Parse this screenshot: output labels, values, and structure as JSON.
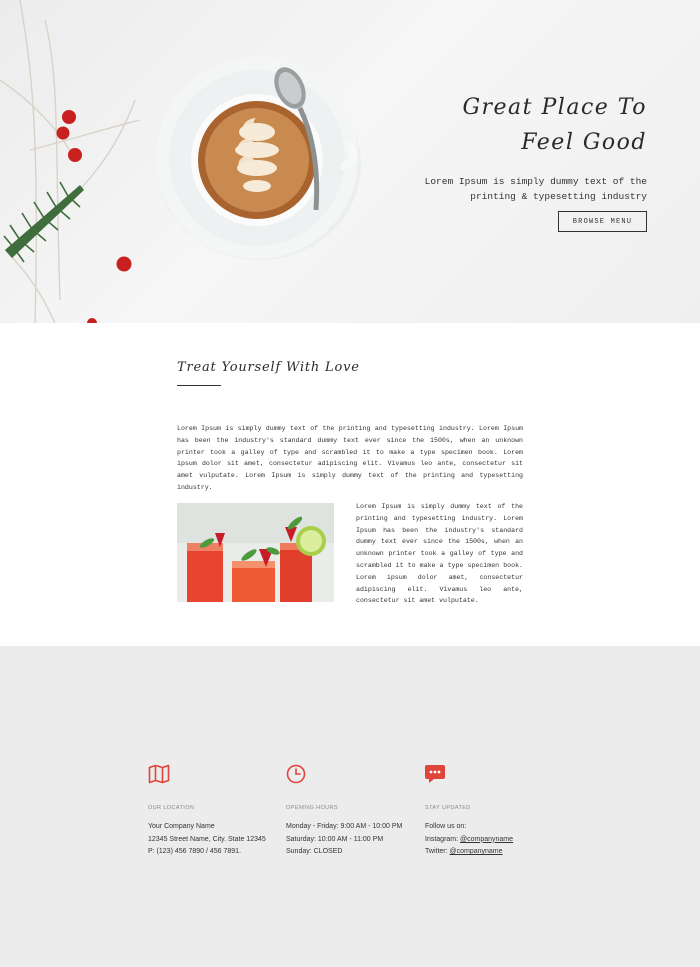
{
  "hero": {
    "title_line1": "Great Place To",
    "title_line2": "Feel Good",
    "subtitle_line1": "Lorem Ipsum is simply dummy text of the",
    "subtitle_line2": "printing & typesetting industry",
    "button_label": "BROWSE MENU"
  },
  "about": {
    "title": "Treat Yourself With Love",
    "paragraph": "Lorem Ipsum is simply dummy text of the printing and typesetting industry. Lorem Ipsum has been the industry's standard dummy text ever since the 1500s, when an unknown printer took a galley of type and scrambled it to make a type specimen book. Lorem ipsum dolor sit amet, consectetur adipiscing elit. Vivamus leo ante, consectetur sit amet vulputate. Lorem Ipsum is simply dummy text of the printing and typesetting industry.",
    "side_paragraph": "Lorem Ipsum is simply dummy text of the printing and typesetting industry. Lorem Ipsum has been the industry's standard dummy text ever since the 1500s, when an unknown printer took a galley of type and scrambled it to make a type specimen book. Lorem ipsum dolor amet, consectetur adipiscing elit. Vivamus leo ante, consectetur sit amet vulputate."
  },
  "footer": {
    "accent_color": "#e0453c",
    "location": {
      "icon": "map-icon",
      "heading": "OUR LOCATION",
      "line1": "Your Company Name",
      "line2": "12345 Street Name, City. State 12345",
      "line3": "P: (123) 456 7890 / 456 7891."
    },
    "hours": {
      "icon": "clock-icon",
      "heading": "OPENING HOURS",
      "line1": "Monday - Friday: 9:00 AM - 10:00 PM",
      "line2": "Saturday: 10:00 AM - 11:00 PM",
      "line3": "Sunday: CLOSED"
    },
    "updated": {
      "icon": "chat-icon",
      "heading": "STAY UPDATED",
      "line1": "Follow us on:",
      "instagram_label": "Instagram: ",
      "instagram_handle": "@companyname",
      "twitter_label": "Twitter: ",
      "twitter_handle": "@companyname"
    }
  }
}
